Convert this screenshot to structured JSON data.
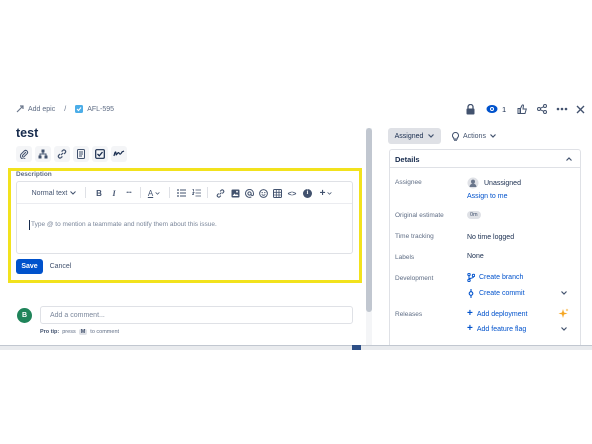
{
  "breadcrumb": {
    "add_epic": "Add epic",
    "separator": "/",
    "issue_key": "AFL-595"
  },
  "header": {
    "watch_count": "1"
  },
  "issue": {
    "title": "test"
  },
  "description": {
    "label": "Description",
    "toolbar": {
      "text_style": "Normal text",
      "bold": "B",
      "italic": "I",
      "more": "•••",
      "color": "A",
      "code": "<>",
      "info": "i",
      "insert": "+"
    },
    "placeholder": "Type @ to mention a teammate and notify them about this issue.",
    "save_label": "Save",
    "cancel_label": "Cancel"
  },
  "comment": {
    "avatar_letter": "B",
    "placeholder": "Add a comment...",
    "pro_tip_bold": "Pro tip:",
    "pro_tip_1": "press",
    "pro_tip_key": "M",
    "pro_tip_2": "to comment"
  },
  "sidebar": {
    "status_label": "Assigned",
    "actions_label": "Actions",
    "details_title": "Details",
    "assignee": {
      "label": "Assignee",
      "value": "Unassigned",
      "assign_to_me": "Assign to me"
    },
    "original_estimate": {
      "label": "Original estimate",
      "value": "0m"
    },
    "time_tracking": {
      "label": "Time tracking",
      "value": "No time logged"
    },
    "labels": {
      "label": "Labels",
      "value": "None"
    },
    "development": {
      "label": "Development",
      "create_branch": "Create branch",
      "create_commit": "Create commit"
    },
    "releases": {
      "label": "Releases",
      "add_deployment": "Add deployment",
      "add_feature_flag": "Add feature flag"
    }
  },
  "colors": {
    "highlight": "#f2e21d",
    "brand": "#0052cc",
    "avatar": "#1f845a"
  }
}
